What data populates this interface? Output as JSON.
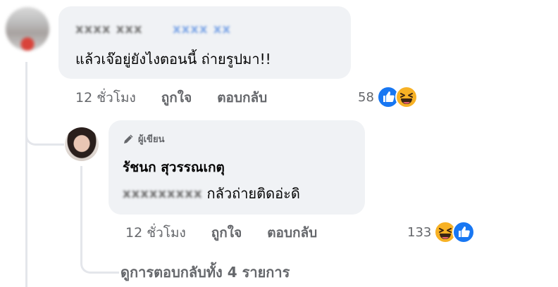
{
  "comment": {
    "author_name_blurred": "xxxx xxx",
    "tag_blurred": "xxxx xx",
    "text": "แล้วเจ๊อยู่ยังไงตอนนี้ ถ่ายรูปมา!!",
    "time": "12 ชั่วโมง",
    "like_label": "ถูกใจ",
    "reply_label": "ตอบกลับ",
    "reaction_count": "58",
    "reactions": [
      "like-icon",
      "haha-icon"
    ]
  },
  "reply": {
    "author_badge": "ผู้เขียน",
    "author_name": "รัชนก สุวรรณเกตุ",
    "mention_blurred": "xxxxxxxxx",
    "text": "กลัวถ่ายติดอ่ะดิ",
    "time": "12 ชั่วโมง",
    "like_label": "ถูกใจ",
    "reply_label": "ตอบกลับ",
    "reaction_count": "133",
    "reactions": [
      "haha-icon",
      "like-icon"
    ]
  },
  "view_more_replies": "ดูการตอบกลับทั้ง 4 รายการ",
  "colors": {
    "bubble": "#f0f2f5",
    "meta_text": "#65676b",
    "like_blue": "#1877f2",
    "haha_yellow": "#f7b125",
    "thread_line": "#e4e6eb"
  }
}
